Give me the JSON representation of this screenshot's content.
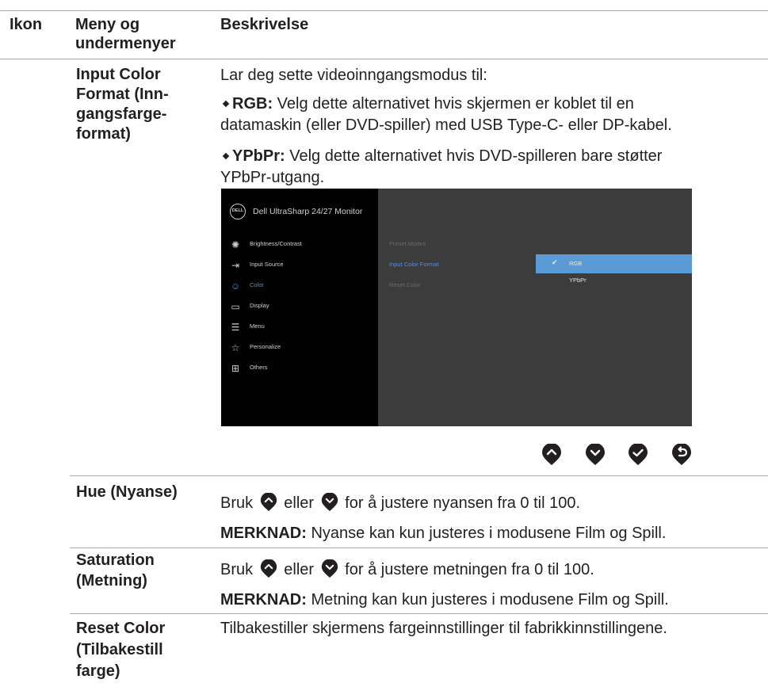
{
  "header": {
    "col_icon": "Ikon",
    "col_menu_line1": "Meny og",
    "col_menu_line2": "undermenyer",
    "col_desc": "Beskrivelse"
  },
  "rows": {
    "input_color": {
      "name_lines": [
        "Input Color",
        "Format (Inn-",
        "gangsfarge-",
        "format)"
      ],
      "intro": "Lar deg sette videoinngangsmodus til:",
      "rgb_term": "RGB:",
      "rgb_line1": " Velg dette alternativet hvis skjermen er koblet til en",
      "rgb_line2": "datamaskin (eller DVD-spiller) med USB Type-C- eller DP-kabel.",
      "ypbpr_term": "YPbPr:",
      "ypbpr_line1": " Velg dette alternativet hvis DVD-spilleren bare støtter",
      "ypbpr_line2": "YPbPr-utgang."
    },
    "hue": {
      "name": "Hue (Nyanse)",
      "text_a": "Bruk",
      "text_b": "eller",
      "text_c": "for å justere nyansen fra 0 til 100.",
      "note_label": "MERKNAD:",
      "note_text": " Nyanse kan kun justeres i modusene Film og Spill."
    },
    "saturation": {
      "name_lines": [
        "Saturation",
        "(Metning)"
      ],
      "text_a": "Bruk",
      "text_b": "eller",
      "text_c": "for å justere metningen fra 0 til 100.",
      "note_label": "MERKNAD:",
      "note_text": " Metning kan kun justeres i modusene Film og Spill."
    },
    "reset": {
      "name_lines": [
        "Reset Color",
        "(Tilbakestill",
        "farge)"
      ],
      "text": "Tilbakestiller skjermens fargeinnstillinger til fabrikkinnstillingene."
    }
  },
  "osd": {
    "logo": "DELL",
    "title": "Dell UltraSharp 24/27 Monitor",
    "menu": [
      {
        "label": "Brightness/Contrast",
        "icon": "brightness-icon"
      },
      {
        "label": "Input Source",
        "icon": "input-source-icon"
      },
      {
        "label": "Color",
        "icon": "color-palette-icon"
      },
      {
        "label": "Display",
        "icon": "display-icon"
      },
      {
        "label": "Menu",
        "icon": "menu-icon"
      },
      {
        "label": "Personalize",
        "icon": "star-icon"
      },
      {
        "label": "Others",
        "icon": "others-icon"
      }
    ],
    "submenu": [
      "Preset Modes",
      "Input Color Format",
      "Reset Color"
    ],
    "options": [
      "RGB",
      "YPbPr"
    ],
    "accent": "#5b9bd5",
    "selected_option": "RGB"
  },
  "nav_buttons": [
    "up-button-icon",
    "down-button-icon",
    "confirm-button-icon",
    "back-button-icon"
  ],
  "colors": {
    "button_fill": "#231f20",
    "rule": "#a7a9ac"
  }
}
